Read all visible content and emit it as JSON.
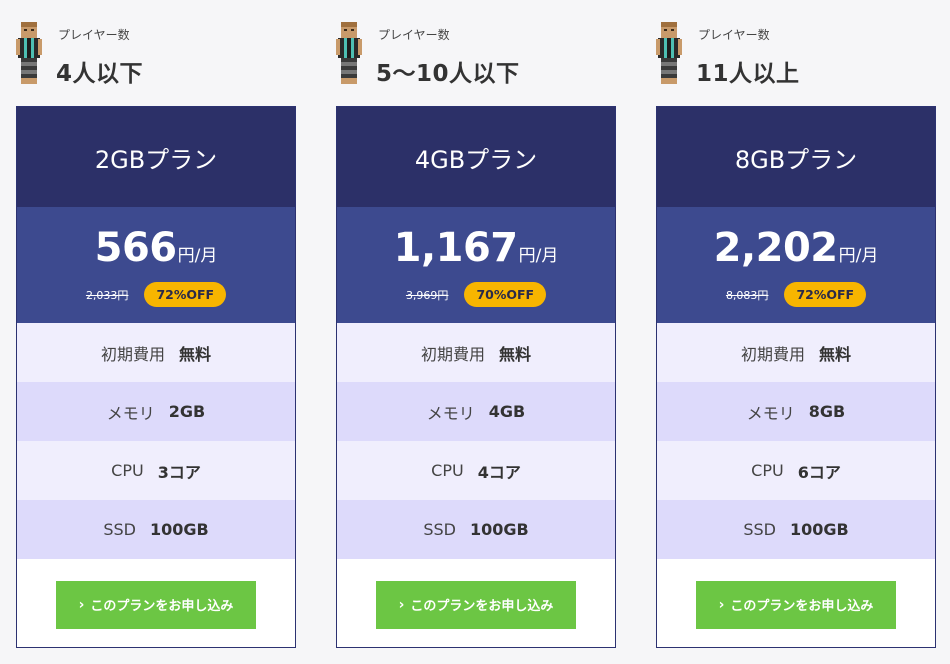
{
  "colors": {
    "card_header": "#2c3068",
    "price_box": "#3d4a8f",
    "badge": "#f7b500",
    "spec_light": "#f0eefd",
    "spec_dark": "#dddafb",
    "button": "#6cc644"
  },
  "plans": [
    {
      "players_label": "プレイヤー数",
      "players_count": "4人以下",
      "name": "2GBプラン",
      "price": "566",
      "price_unit": "円/月",
      "old_price": "2,033円",
      "discount": "72%OFF",
      "specs": [
        {
          "label": "初期費用",
          "value": "無料"
        },
        {
          "label": "メモリ",
          "value": "2GB"
        },
        {
          "label": "CPU",
          "value": "3コア"
        },
        {
          "label": "SSD",
          "value": "100GB"
        }
      ],
      "button_label": "このプランをお申し込み",
      "button_icon": "chevron-right-icon"
    },
    {
      "players_label": "プレイヤー数",
      "players_count": "5〜10人以下",
      "name": "4GBプラン",
      "price": "1,167",
      "price_unit": "円/月",
      "old_price": "3,969円",
      "discount": "70%OFF",
      "specs": [
        {
          "label": "初期費用",
          "value": "無料"
        },
        {
          "label": "メモリ",
          "value": "4GB"
        },
        {
          "label": "CPU",
          "value": "4コア"
        },
        {
          "label": "SSD",
          "value": "100GB"
        }
      ],
      "button_label": "このプランをお申し込み",
      "button_icon": "chevron-right-icon"
    },
    {
      "players_label": "プレイヤー数",
      "players_count": "11人以上",
      "name": "8GBプラン",
      "price": "2,202",
      "price_unit": "円/月",
      "old_price": "8,083円",
      "discount": "72%OFF",
      "specs": [
        {
          "label": "初期費用",
          "value": "無料"
        },
        {
          "label": "メモリ",
          "value": "8GB"
        },
        {
          "label": "CPU",
          "value": "6コア"
        },
        {
          "label": "SSD",
          "value": "100GB"
        }
      ],
      "button_label": "このプランをお申し込み",
      "button_icon": "chevron-right-icon"
    }
  ]
}
